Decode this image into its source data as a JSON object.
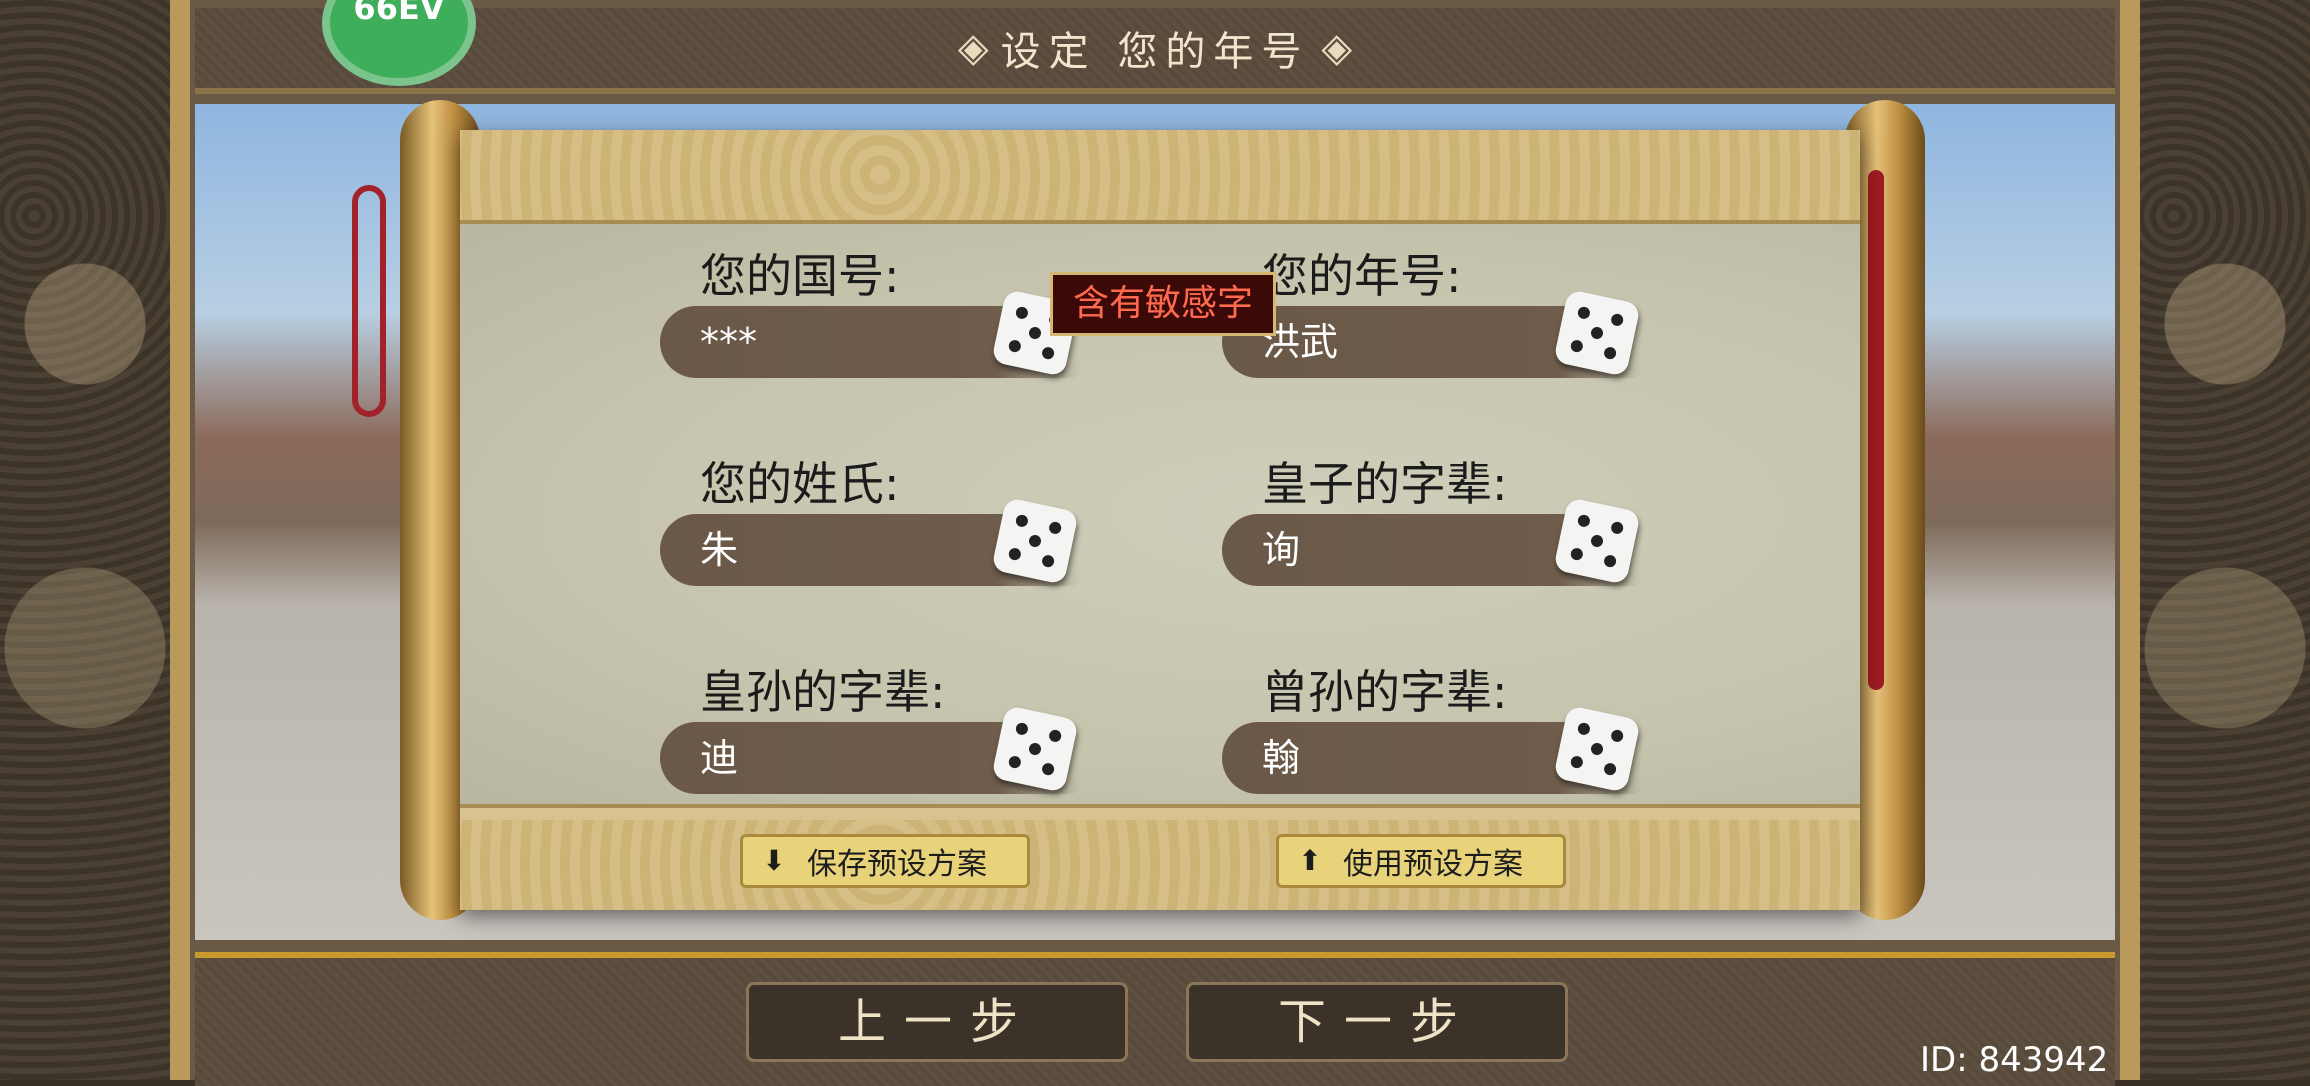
{
  "header": {
    "title": "设定 您的年号",
    "logo_text": "66EV"
  },
  "warning": "含有敏感字",
  "fields": [
    {
      "label": "您的国号:",
      "value": "***"
    },
    {
      "label": "您的年号:",
      "value": "洪武"
    },
    {
      "label": "您的姓氏:",
      "value": "朱"
    },
    {
      "label": "皇子的字辈:",
      "value": "询"
    },
    {
      "label": "皇孙的字辈:",
      "value": "迪"
    },
    {
      "label": "曾孙的字辈:",
      "value": "翰"
    }
  ],
  "preset": {
    "save_label": "保存预设方案",
    "use_label": "使用预设方案"
  },
  "nav": {
    "prev_label": "上一步",
    "next_label": "下一步"
  },
  "footer": {
    "id_text": "ID: 843942"
  },
  "colors": {
    "warning_text": "#ff6a4e",
    "preset_button": "#e8d27a",
    "brush": "#6f5c4b"
  }
}
